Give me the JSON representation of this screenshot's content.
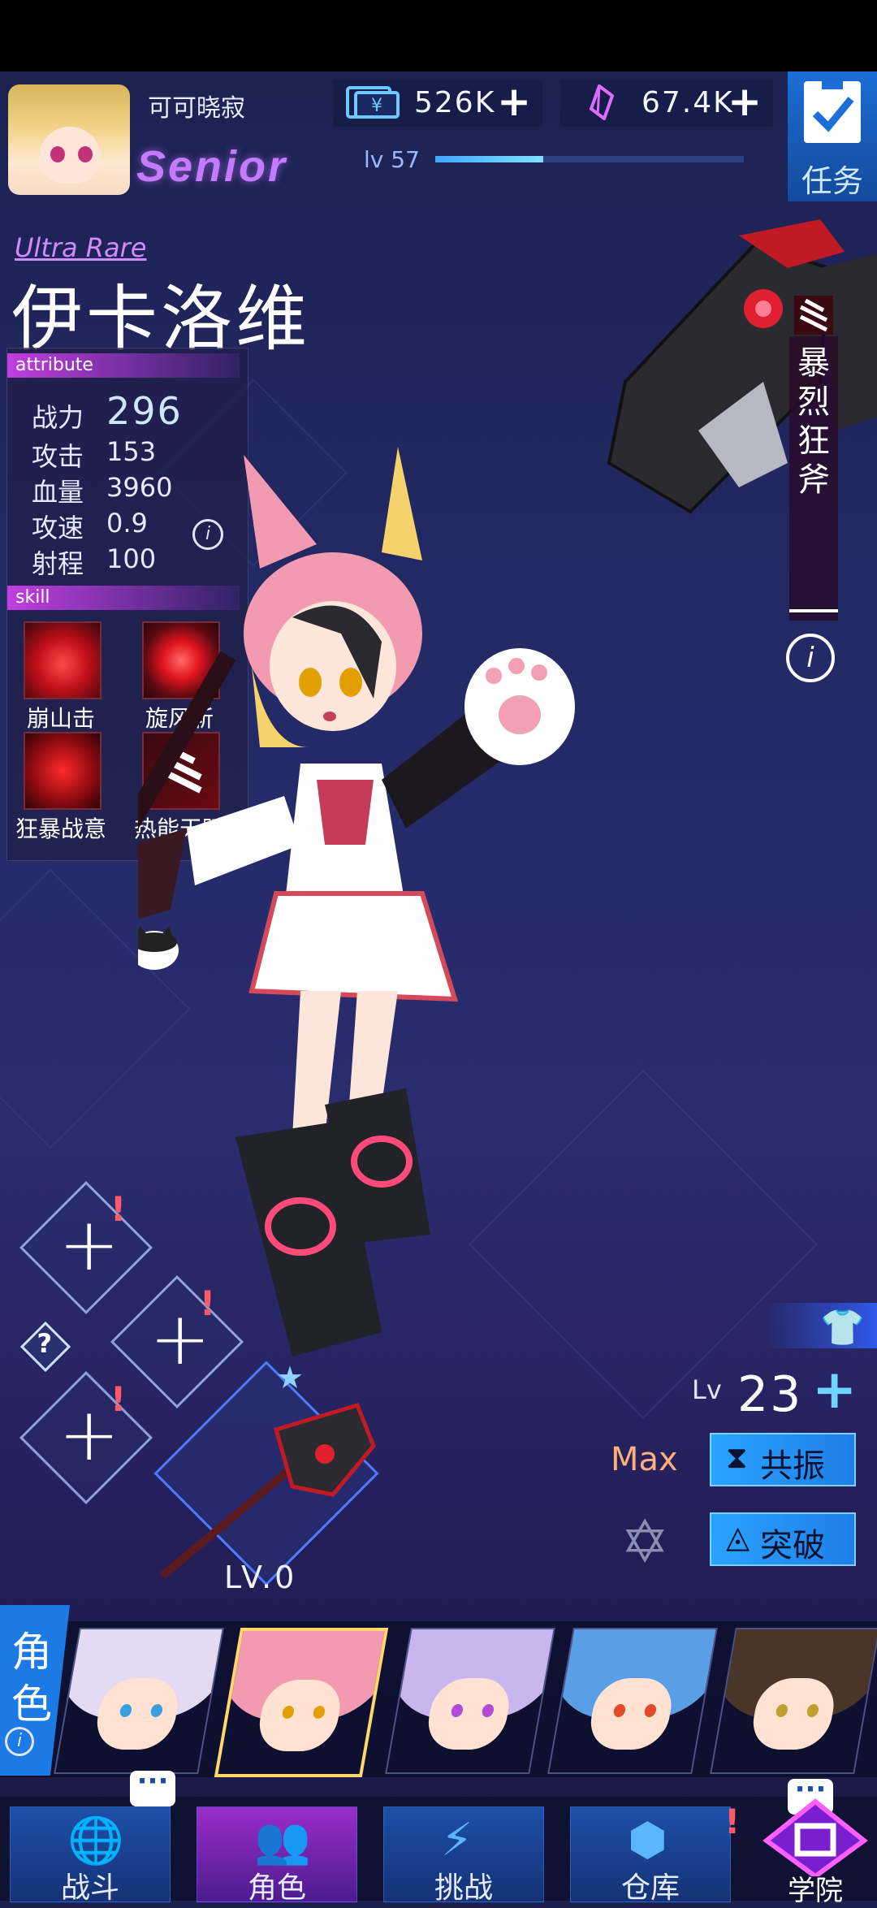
{
  "user": {
    "name": "可可晓寂",
    "rank": "Senior",
    "level_label": "lv 57",
    "level_progress": 0.35
  },
  "resources": [
    {
      "icon": "yen-ticket-icon",
      "value": "526K"
    },
    {
      "icon": "crystal-icon",
      "value": "67.4K"
    }
  ],
  "task_label": "任务",
  "character": {
    "rarity": "Ultra Rare",
    "name": "伊卡洛维",
    "attribute_title": "attribute",
    "stats": [
      {
        "label": "战力",
        "value": "296"
      },
      {
        "label": "攻击",
        "value": "153"
      },
      {
        "label": "血量",
        "value": "3960"
      },
      {
        "label": "攻速",
        "value": "0.9"
      },
      {
        "label": "射程",
        "value": "100"
      }
    ],
    "skill_title": "skill",
    "skills": [
      "崩山击",
      "旋风斩",
      "狂暴战意",
      "热能天赋"
    ]
  },
  "weapon": {
    "name": "暴烈狂斧",
    "name_chars": [
      "暴",
      "烈",
      "狂",
      "斧"
    ],
    "level": "LV.0"
  },
  "level_panel": {
    "lv_label": "Lv",
    "level": "23",
    "max_label": "Max",
    "resonate": "共振",
    "breakthrough": "突破"
  },
  "roster": {
    "label_chars": [
      "角",
      "色"
    ]
  },
  "nav": [
    {
      "label": "战斗",
      "icon": "globe-icon"
    },
    {
      "label": "角色",
      "icon": "people-icon"
    },
    {
      "label": "挑战",
      "icon": "lightning-icon"
    },
    {
      "label": "仓库",
      "icon": "cube-icon"
    },
    {
      "label": "学院",
      "icon": "academy-icon"
    }
  ],
  "colors": {
    "accent_blue": "#1f7fe8",
    "accent_purple": "#c03ee0",
    "alert_red": "#ff5a6a"
  }
}
